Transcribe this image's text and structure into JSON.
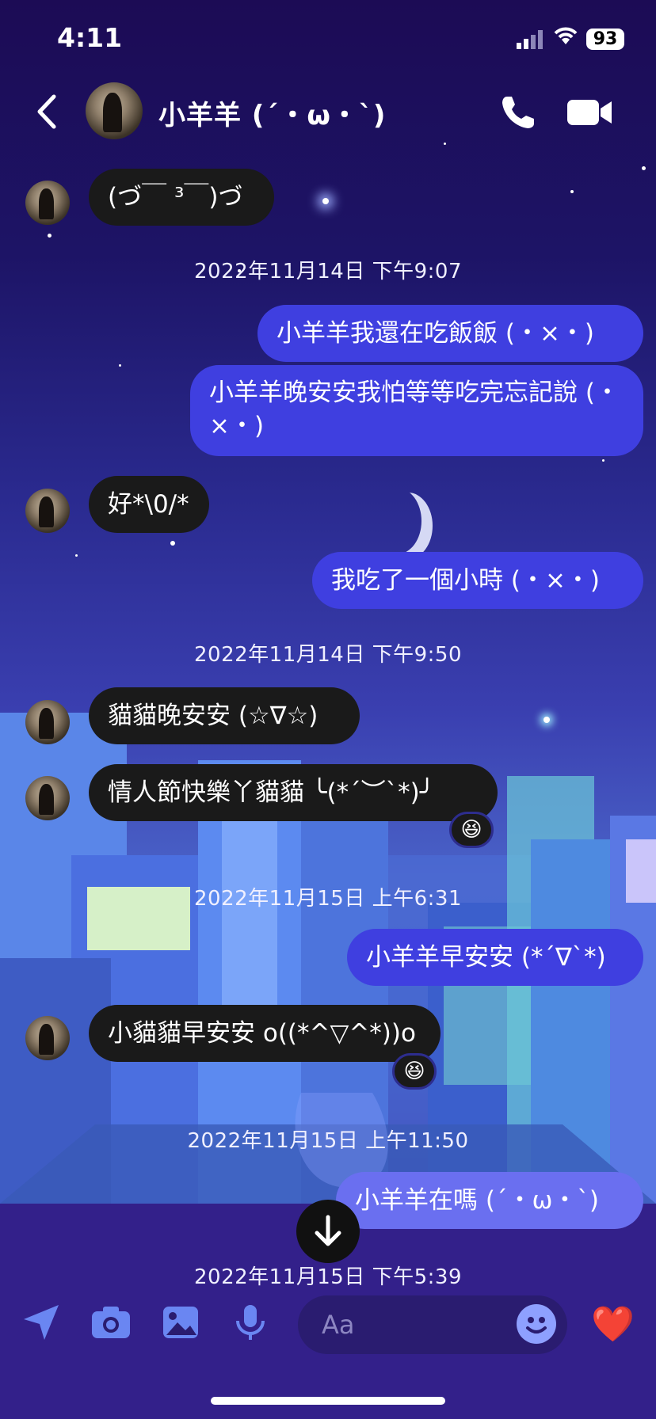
{
  "status": {
    "time": "4:11",
    "battery": "93"
  },
  "header": {
    "title": "小羊羊 (´・ω・`)"
  },
  "messages": [
    {
      "kind": "in",
      "text": "(づ￣ ³￣)づ"
    },
    {
      "kind": "time",
      "text": "2022年11月14日 下午9:07"
    },
    {
      "kind": "out",
      "text": "小羊羊我還在吃飯飯 (・×・)"
    },
    {
      "kind": "out",
      "text": "小羊羊晚安安我怕等等吃完忘記說 (・×・)"
    },
    {
      "kind": "in",
      "text": "好*\\0/*"
    },
    {
      "kind": "out",
      "text": "我吃了一個小時 (・×・)"
    },
    {
      "kind": "time",
      "text": "2022年11月14日 下午9:50"
    },
    {
      "kind": "in",
      "text": "貓貓晚安安 (☆∇☆)"
    },
    {
      "kind": "in",
      "text": "情人節快樂丫貓貓 ╰(*´︶`*)╯",
      "reaction": "😆"
    },
    {
      "kind": "time",
      "text": "2022年11月15日 上午6:31"
    },
    {
      "kind": "out",
      "text": "小羊羊早安安 (*´∇`*)"
    },
    {
      "kind": "in",
      "text": "小貓貓早安安 o((*^▽^*))o",
      "reaction": "😆"
    },
    {
      "kind": "time",
      "text": "2022年11月15日 上午11:50"
    },
    {
      "kind": "out",
      "text": "小羊羊在嗎 (´・ω・`)"
    },
    {
      "kind": "time",
      "text": "2022年11月15日 下午5:39"
    }
  ],
  "composer": {
    "placeholder": "Aa",
    "like": "❤️"
  },
  "icons": [
    "back-icon",
    "phone-icon",
    "video-icon",
    "location-icon",
    "camera-icon",
    "gallery-icon",
    "microphone-icon",
    "emoji-icon",
    "scroll-down-icon"
  ]
}
